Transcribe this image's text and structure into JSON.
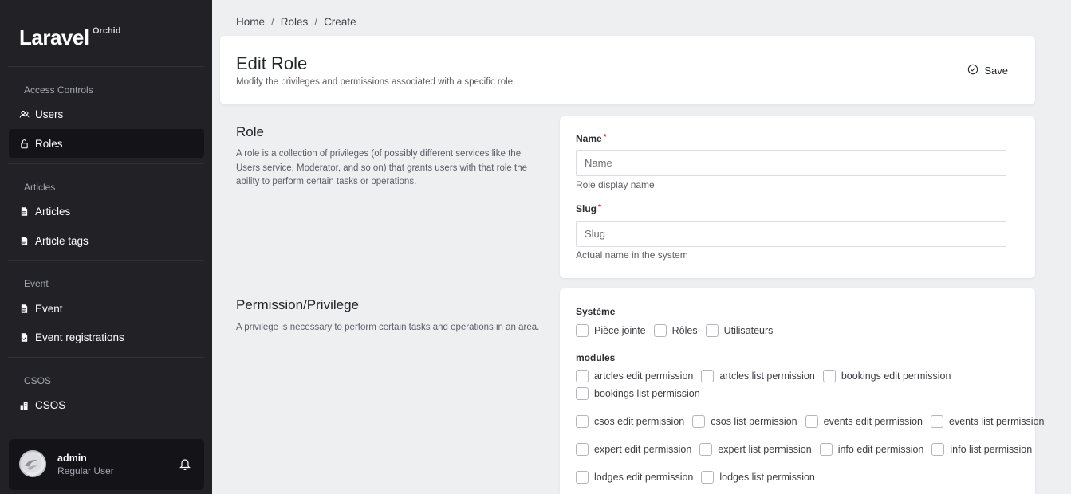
{
  "brand": {
    "name": "Laravel",
    "sub": "Orchid"
  },
  "sidebar": {
    "sections": [
      {
        "title": "Access Controls",
        "items": [
          {
            "label": "Users",
            "icon": "users-icon"
          },
          {
            "label": "Roles",
            "icon": "lock-icon",
            "active": true
          }
        ]
      },
      {
        "title": "Articles",
        "items": [
          {
            "label": "Articles",
            "icon": "document-icon"
          },
          {
            "label": "Article tags",
            "icon": "document-icon"
          }
        ]
      },
      {
        "title": "Event",
        "items": [
          {
            "label": "Event",
            "icon": "document-icon"
          },
          {
            "label": "Event registrations",
            "icon": "document-check-icon"
          }
        ]
      },
      {
        "title": "CSOS",
        "items": [
          {
            "label": "CSOS",
            "icon": "building-icon"
          }
        ]
      }
    ]
  },
  "user": {
    "name": "admin",
    "role": "Regular User"
  },
  "breadcrumb": [
    "Home",
    "Roles",
    "Create"
  ],
  "header": {
    "title": "Edit Role",
    "description": "Modify the privileges and permissions associated with a specific role.",
    "save_label": "Save"
  },
  "role_section": {
    "title": "Role",
    "description": "A role is a collection of privileges (of possibly different services like the Users service, Moderator, and so on) that grants users with that role the ability to perform certain tasks or operations.",
    "name_label": "Name",
    "name_placeholder": "Name",
    "name_help": "Role display name",
    "slug_label": "Slug",
    "slug_placeholder": "Slug",
    "slug_help": "Actual name in the system"
  },
  "permission_section": {
    "title": "Permission/Privilege",
    "description": "A privilege is necessary to perform certain tasks and operations in an area.",
    "groups": [
      {
        "title": "Système",
        "rows": [
          [
            "Pièce jointe",
            "Rôles",
            "Utilisateurs"
          ]
        ]
      },
      {
        "title": "modules",
        "rows": [
          [
            "artcles edit permission",
            "artcles list permission",
            "bookings edit permission"
          ],
          [
            "bookings list permission"
          ],
          [
            "csos edit permission",
            "csos list permission",
            "events edit permission",
            "events list permission"
          ],
          [
            "expert edit permission",
            "expert list permission",
            "info edit permission",
            "info list permission"
          ],
          [
            "lodges edit permission",
            "lodges list permission"
          ]
        ]
      }
    ]
  },
  "colors": {
    "sidebar_bg": "#212126",
    "active_item_bg": "#141418",
    "page_bg": "#eeeff1",
    "required": "#e3342f"
  }
}
